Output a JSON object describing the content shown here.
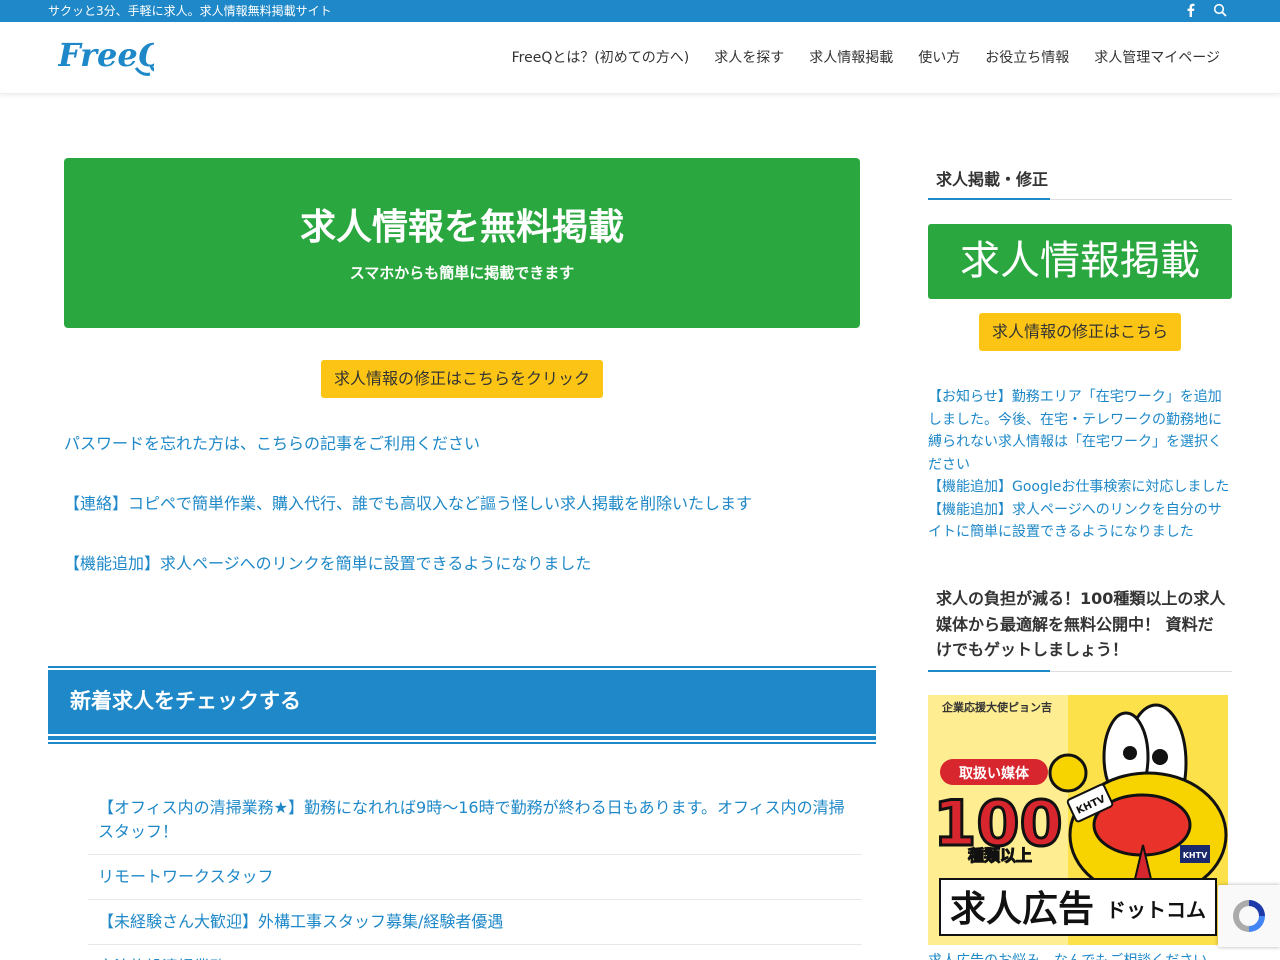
{
  "topbar": {
    "tagline": "サクッと3分、手軽に求人。求人情報無料掲載サイト",
    "icons": [
      "facebook-icon",
      "search-icon"
    ]
  },
  "header": {
    "logo_text": "FreeQ",
    "nav": [
      "FreeQとは？(初めての方へ)",
      "求人を探す",
      "求人情報掲載",
      "使い方",
      "お役立ち情報",
      "求人管理マイページ"
    ]
  },
  "main": {
    "hero_title": "求人情報を無料掲載",
    "hero_subtitle": "スマホからも簡単に掲載できます",
    "edit_button": "求人情報の修正はこちらをクリック",
    "links": [
      "パスワードを忘れた方は、こちらの記事をご利用ください",
      "【連絡】コピペで簡単作業、購入代行、誰でも高収入など謳う怪しい求人掲載を削除いたします",
      "【機能追加】求人ページへのリンクを簡単に設置できるようになりました"
    ],
    "section_title": "新着求人をチェックする",
    "jobs": [
      "【オフィス内の清掃業務★】勤務になれれば9時～16時で勤務が終わる日もあります。オフィス内の清掃スタッフ！",
      "リモートワークスタッフ",
      "【未経験さん大歓迎】外構工事スタッフ募集/経験者優遇",
      "宿泊施設清掃業務"
    ]
  },
  "sidebar": {
    "heading1": "求人掲載・修正",
    "green_button": "求人情報掲載",
    "edit_button": "求人情報の修正はこちら",
    "news": [
      "【お知らせ】勤務エリア「在宅ワーク」を追加しました。今後、在宅・テレワークの勤務地に縛られない求人情報は「在宅ワーク」を選択ください",
      "【機能追加】Googleお仕事検索に対応しました",
      "【機能追加】求人ページへのリンクを自分のサイトに簡単に設置できるようになりました"
    ],
    "heading2": "求人の負担が減る！100種類以上の求人媒体から最適解を無料公開中！ 資料だけでもゲットしましょう！",
    "banner": {
      "top_label": "企業応援大使ピョン吉",
      "badge": "取扱い媒体",
      "number": "100",
      "unit": "種類以上",
      "brand_main": "求人広告",
      "brand_suffix": "ドットコム",
      "mic_text": "KHTV",
      "tag_text": "KHTV"
    },
    "bottom_text": "求人広告のお悩み、なんでもご相談ください"
  },
  "colors": {
    "brand_blue": "#1e88c8",
    "green": "#2ba73f",
    "yellow": "#fcc516"
  }
}
